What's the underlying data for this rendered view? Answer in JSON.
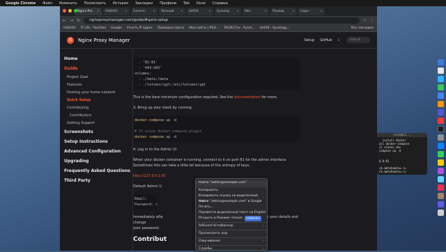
{
  "menubar": {
    "app": "Google Chrome",
    "items": [
      "Файл",
      "Изменить",
      "Посмотреть",
      "История",
      "Закладки",
      "Профили",
      "Tab",
      "Окно",
      "Справка"
    ]
  },
  "tabs": [
    {
      "label": "Nginx Pro",
      "active": true
    },
    {
      "label": "HS8245",
      "active": false
    },
    {
      "label": "Generic",
      "active": false
    },
    {
      "label": "Личный",
      "active": false
    },
    {
      "label": "ds918",
      "active": false
    },
    {
      "label": "Synolog",
      "active": false
    },
    {
      "label": "litle",
      "active": false
    },
    {
      "label": "Провер",
      "active": false
    },
    {
      "label": "Login -",
      "active": false
    }
  ],
  "address": {
    "url": "nginxproxymanager.com/guide/#quick-setup"
  },
  "bookmarks": [
    "HS8245",
    "IT Life - YouTube",
    "Google",
    "Узнать IP адрес",
    "Проверка порта",
    "Мои сайты | REG...",
    "DS3617xx - Synol...",
    "ds918 - Synology..."
  ],
  "bookmarks_right": "Все закладки",
  "site": {
    "title": "Nginx Proxy Manager",
    "nav": [
      "Setup",
      "GitHub"
    ],
    "search_placeholder": "Search"
  },
  "sidebar": {
    "items": [
      {
        "label": "Home",
        "level": 1
      },
      {
        "label": "Guide",
        "level": 1,
        "active": true
      },
      {
        "label": "Project Goal",
        "level": 2
      },
      {
        "label": "Features",
        "level": 2
      },
      {
        "label": "Hosting your home network",
        "level": 2
      },
      {
        "label": "Quick Setup",
        "level": 2,
        "active": true
      },
      {
        "label": "Contributing",
        "level": 2
      },
      {
        "label": "Contributors",
        "level": 3
      },
      {
        "label": "Getting Support",
        "level": 2
      },
      {
        "label": "Screenshots",
        "level": 1
      },
      {
        "label": "Setup Instructions",
        "level": 1
      },
      {
        "label": "Advanced Configuration",
        "level": 1
      },
      {
        "label": "Upgrading",
        "level": 1
      },
      {
        "label": "Frequently Asked Questions",
        "level": 1
      },
      {
        "label": "Third Party",
        "level": 1
      }
    ]
  },
  "content": {
    "code1": "  - '81:81'\n  - '443:443'\nvolumes:\n  - ./data:/data\n  - ./letsencrypt:/etc/letsencrypt",
    "p1a": "This is the bare minimum configuration required. See the ",
    "p1link": "documentation",
    "p1b": " for more.",
    "p2": "3. Bring up your stack by running",
    "code2a": "docker-compose",
    "code2b": " up -d",
    "code2c": "# If using docker-compose-plugin",
    "code2d": "docker compose",
    "code2e": " up -d",
    "p3": "4. Log in to the Admin UI",
    "p4": "When your docker container is running, connect to it on port 81 for the admin interface. Sometimes this can take a little bit because of the entropy of keys.",
    "link2": "http://127.0.0.1:81",
    "p5": "Default Admin U",
    "email": "Email:",
    "password": "Password: c",
    "p6a": "Immediately afte",
    "p6b": "asked to modify your details and change",
    "p6c": "your password.",
    "heading": "Contribut"
  },
  "context_menu": {
    "items": [
      {
        "label": "Найти \"admin@example.com\""
      },
      {
        "sep": true
      },
      {
        "label": "Копировать"
      },
      {
        "label": "Копировать ссылку на выделенный текст"
      },
      {
        "label": "Найти \"admin@example.com\" в Google"
      },
      {
        "label": "Печать..."
      },
      {
        "label": "Перевести выделенный текст на English"
      },
      {
        "label": "Открыть в Режиме чтения",
        "badge": "НОВИНКА"
      },
      {
        "sep": true
      },
      {
        "label": "AdGuard Антибаннер",
        "arrow": true
      },
      {
        "sep": true
      },
      {
        "label": "Просмотреть код"
      },
      {
        "sep": true
      },
      {
        "label": "Озвучивание",
        "arrow": true
      },
      {
        "sep": true
      },
      {
        "label": "Службы",
        "arrow": true
      }
    ]
  },
  "terminal": {
    "title": "root@ds1...",
    "lines": [
      "  install docker",
      "all docker-compose",
      "il status doc",
      "compose up -d",
      " ",
      "",
      "8.0:81",
      "",
      "ck.amtehomelw.ru",
      "ck.amtehomelw.ru"
    ]
  },
  "colors": {
    "accent": "#f15833"
  }
}
